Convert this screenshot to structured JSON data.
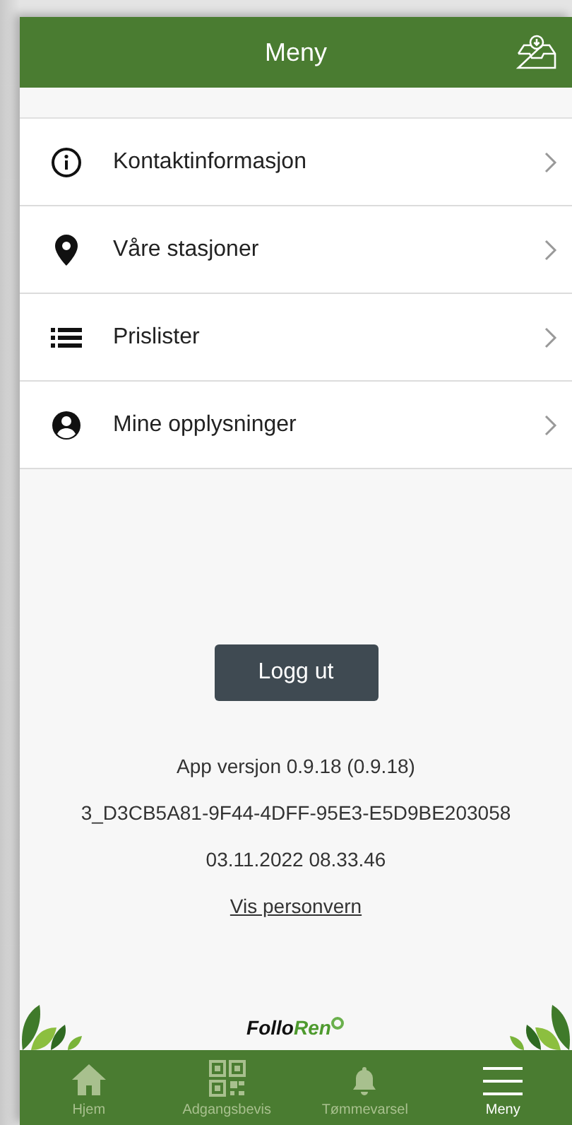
{
  "header": {
    "title": "Meny"
  },
  "menu": [
    {
      "label": "Kontaktinformasjon",
      "kind": "info"
    },
    {
      "label": "Våre stasjoner",
      "kind": "pin"
    },
    {
      "label": "Prislister",
      "kind": "list"
    },
    {
      "label": "Mine opplysninger",
      "kind": "user"
    }
  ],
  "logout": "Logg ut",
  "info_lines": [
    "App versjon 0.9.18 (0.9.18)",
    "3_D3CB5A81-9F44-4DFF-95E3-E5D9BE203058",
    "03.11.2022 08.33.46"
  ],
  "privacy_link": "Vis personvern",
  "logo": {
    "dark": "Follo",
    "green": "Ren"
  },
  "tabs": [
    {
      "label": "Hjem",
      "kind": "home",
      "selected": false
    },
    {
      "label": "Adgangsbevis",
      "kind": "qr",
      "selected": false
    },
    {
      "label": "Tømmevarsel",
      "kind": "bell",
      "selected": false
    },
    {
      "label": "Meny",
      "kind": "menu",
      "selected": true
    }
  ]
}
